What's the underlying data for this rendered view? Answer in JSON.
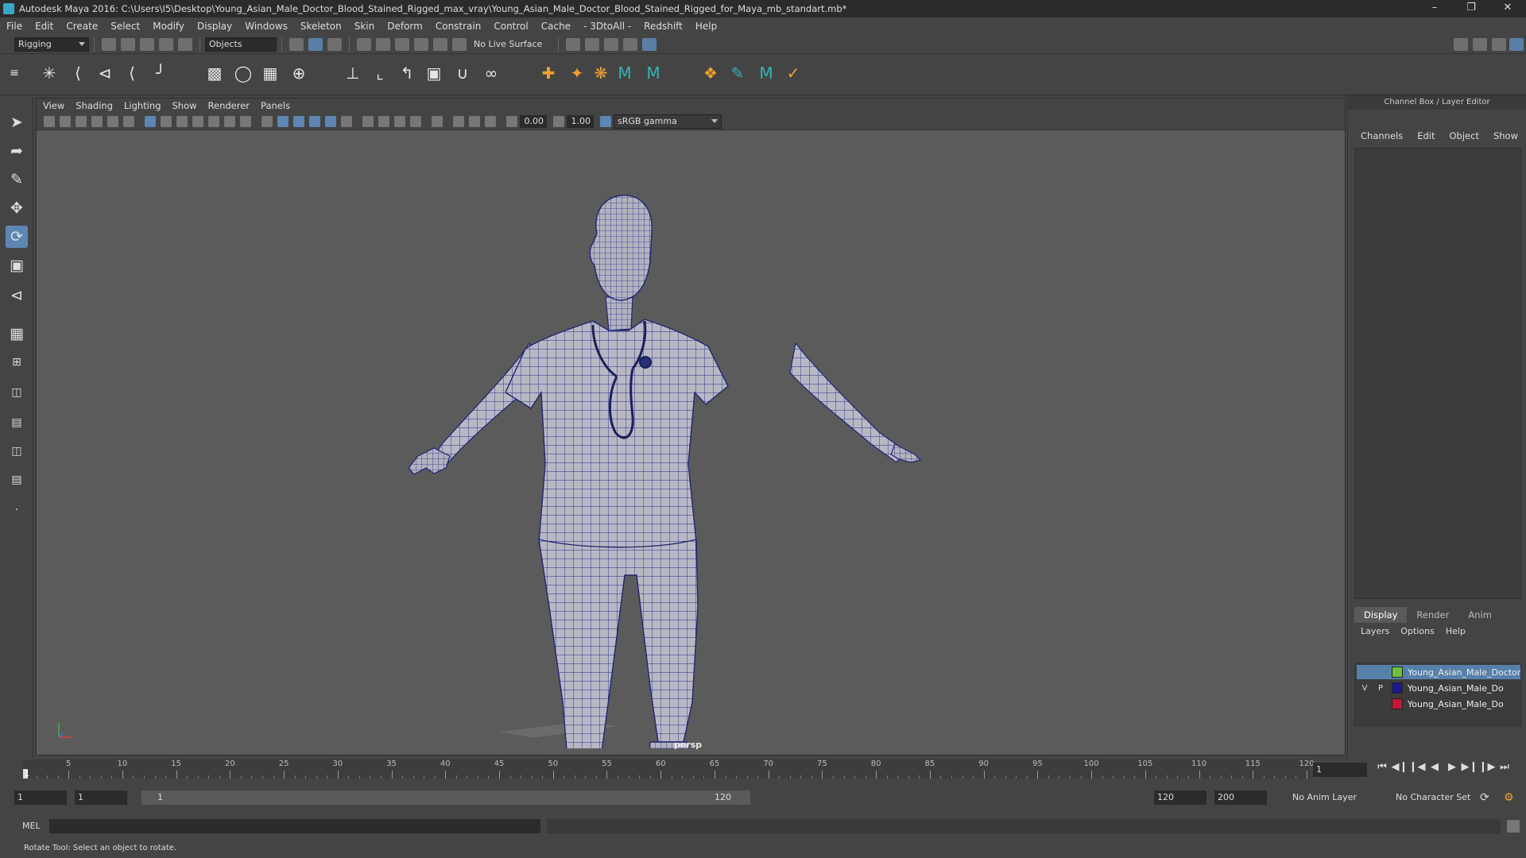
{
  "window": {
    "title": "Autodesk Maya 2016: C:\\Users\\I5\\Desktop\\Young_Asian_Male_Doctor_Blood_Stained_Rigged_max_vray\\Young_Asian_Male_Doctor_Blood_Stained_Rigged_for_Maya_mb_standart.mb*",
    "minimize": "–",
    "restore": "❐",
    "close": "✕"
  },
  "menubar": [
    "File",
    "Edit",
    "Create",
    "Select",
    "Modify",
    "Display",
    "Windows",
    "Skeleton",
    "Skin",
    "Deform",
    "Constrain",
    "Control",
    "Cache",
    "- 3DtoAll -",
    "Redshift",
    "Help"
  ],
  "statusline": {
    "menuset": "Rigging",
    "selection_mode": "Objects",
    "live_surface": "No Live Surface"
  },
  "viewport": {
    "menu": [
      "View",
      "Shading",
      "Lighting",
      "Show",
      "Renderer",
      "Panels"
    ],
    "exposure": "0.00",
    "gamma": "1.00",
    "color_space": "sRGB gamma",
    "camera": "persp"
  },
  "channel_box": {
    "title": "Channel Box / Layer Editor",
    "menu": [
      "Channels",
      "Edit",
      "Object",
      "Show"
    ],
    "layer_tabs": [
      "Display",
      "Render",
      "Anim"
    ],
    "selected_tab": "Display",
    "layer_menu": [
      "Layers",
      "Options",
      "Help"
    ],
    "layers": [
      {
        "v": "",
        "p": "",
        "color": "#6fbf3c",
        "name": "Young_Asian_Male_Doctor_B",
        "selected": true
      },
      {
        "v": "V",
        "p": "P",
        "color": "#1a1a8a",
        "name": "Young_Asian_Male_Do",
        "selected": false
      },
      {
        "v": "",
        "p": "",
        "color": "#c0173a",
        "name": "Young_Asian_Male_Do",
        "selected": false
      }
    ]
  },
  "timeline": {
    "start_tick": "1",
    "ticks": [
      "5",
      "10",
      "15",
      "20",
      "25",
      "30",
      "35",
      "40",
      "45",
      "50",
      "55",
      "60",
      "65",
      "70",
      "75",
      "80",
      "85",
      "90",
      "95",
      "100",
      "105",
      "110",
      "115",
      "120"
    ],
    "current_frame": "1"
  },
  "range": {
    "start": "1",
    "playback_start": "1",
    "range_start": "1",
    "range_end": "120",
    "playback_end": "120",
    "end": "200",
    "anim_layer": "No Anim Layer",
    "character_set": "No Character Set"
  },
  "command": {
    "language": "MEL"
  },
  "help_line": "Rotate Tool: Select an object to rotate."
}
